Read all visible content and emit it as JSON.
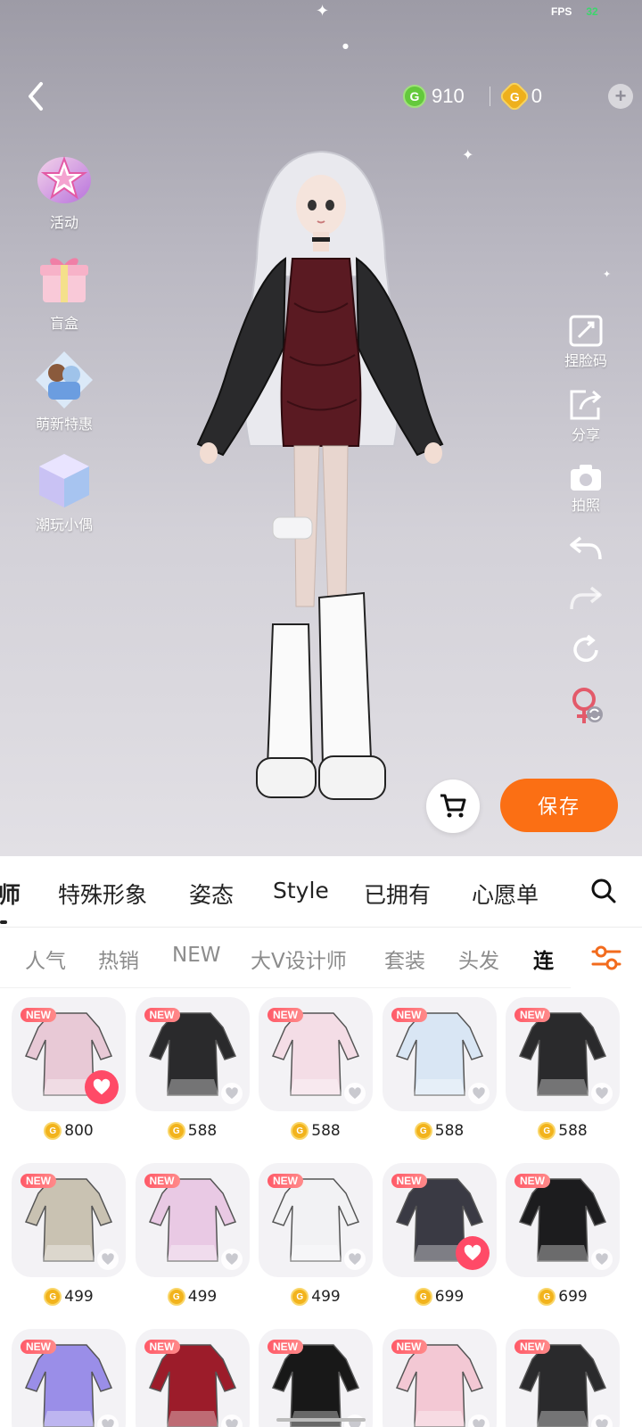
{
  "status": {
    "fps_label": "FPS",
    "fps_value": "32"
  },
  "header": {
    "back_icon": "chevron-left-icon",
    "currency": [
      {
        "icon": "green-coin",
        "color": "#64c93c",
        "value": "910"
      },
      {
        "icon": "gold-coin",
        "color": "#eeb01c",
        "value": "0"
      }
    ],
    "add_icon": "plus-circle-icon"
  },
  "left_menu": [
    {
      "label": "活动",
      "icon": "star-badge-icon"
    },
    {
      "label": "盲盒",
      "icon": "gift-box-icon"
    },
    {
      "label": "萌新特惠",
      "icon": "newbie-deal-icon"
    },
    {
      "label": "潮玩小偶",
      "icon": "figure-box-icon"
    }
  ],
  "right_tools": [
    {
      "label": "捏脸码",
      "icon": "face-code-icon"
    },
    {
      "label": "分享",
      "icon": "share-icon"
    },
    {
      "label": "拍照",
      "icon": "camera-icon"
    },
    {
      "label": "",
      "icon": "undo-icon"
    },
    {
      "label": "",
      "icon": "redo-icon"
    },
    {
      "label": "",
      "icon": "reset-icon"
    },
    {
      "label": "",
      "icon": "gender-switch-icon"
    }
  ],
  "actions": {
    "cart_icon": "cart-icon",
    "save_label": "保存"
  },
  "tabs": [
    "师",
    "特殊形象",
    "姿态",
    "Style",
    "已拥有",
    "心愿单"
  ],
  "subtabs": [
    "人气",
    "热销",
    "NEW",
    "大V设计师",
    "套装",
    "头发",
    "连"
  ],
  "new_label": "NEW",
  "items": [
    {
      "price": "800",
      "fav": true
    },
    {
      "price": "588",
      "fav": false
    },
    {
      "price": "588",
      "fav": false
    },
    {
      "price": "588",
      "fav": false
    },
    {
      "price": "588",
      "fav": false
    },
    {
      "price": "499",
      "fav": false
    },
    {
      "price": "499",
      "fav": false
    },
    {
      "price": "499",
      "fav": false
    },
    {
      "price": "699",
      "fav": true
    },
    {
      "price": "699",
      "fav": false
    },
    {
      "price": "",
      "fav": false
    },
    {
      "price": "",
      "fav": false
    },
    {
      "price": "",
      "fav": false
    },
    {
      "price": "",
      "fav": false
    },
    {
      "price": "",
      "fav": false
    }
  ],
  "colors": {
    "accent": "#fb6f14",
    "favorite": "#ff4a67",
    "new_badge": "#ff5a68"
  }
}
